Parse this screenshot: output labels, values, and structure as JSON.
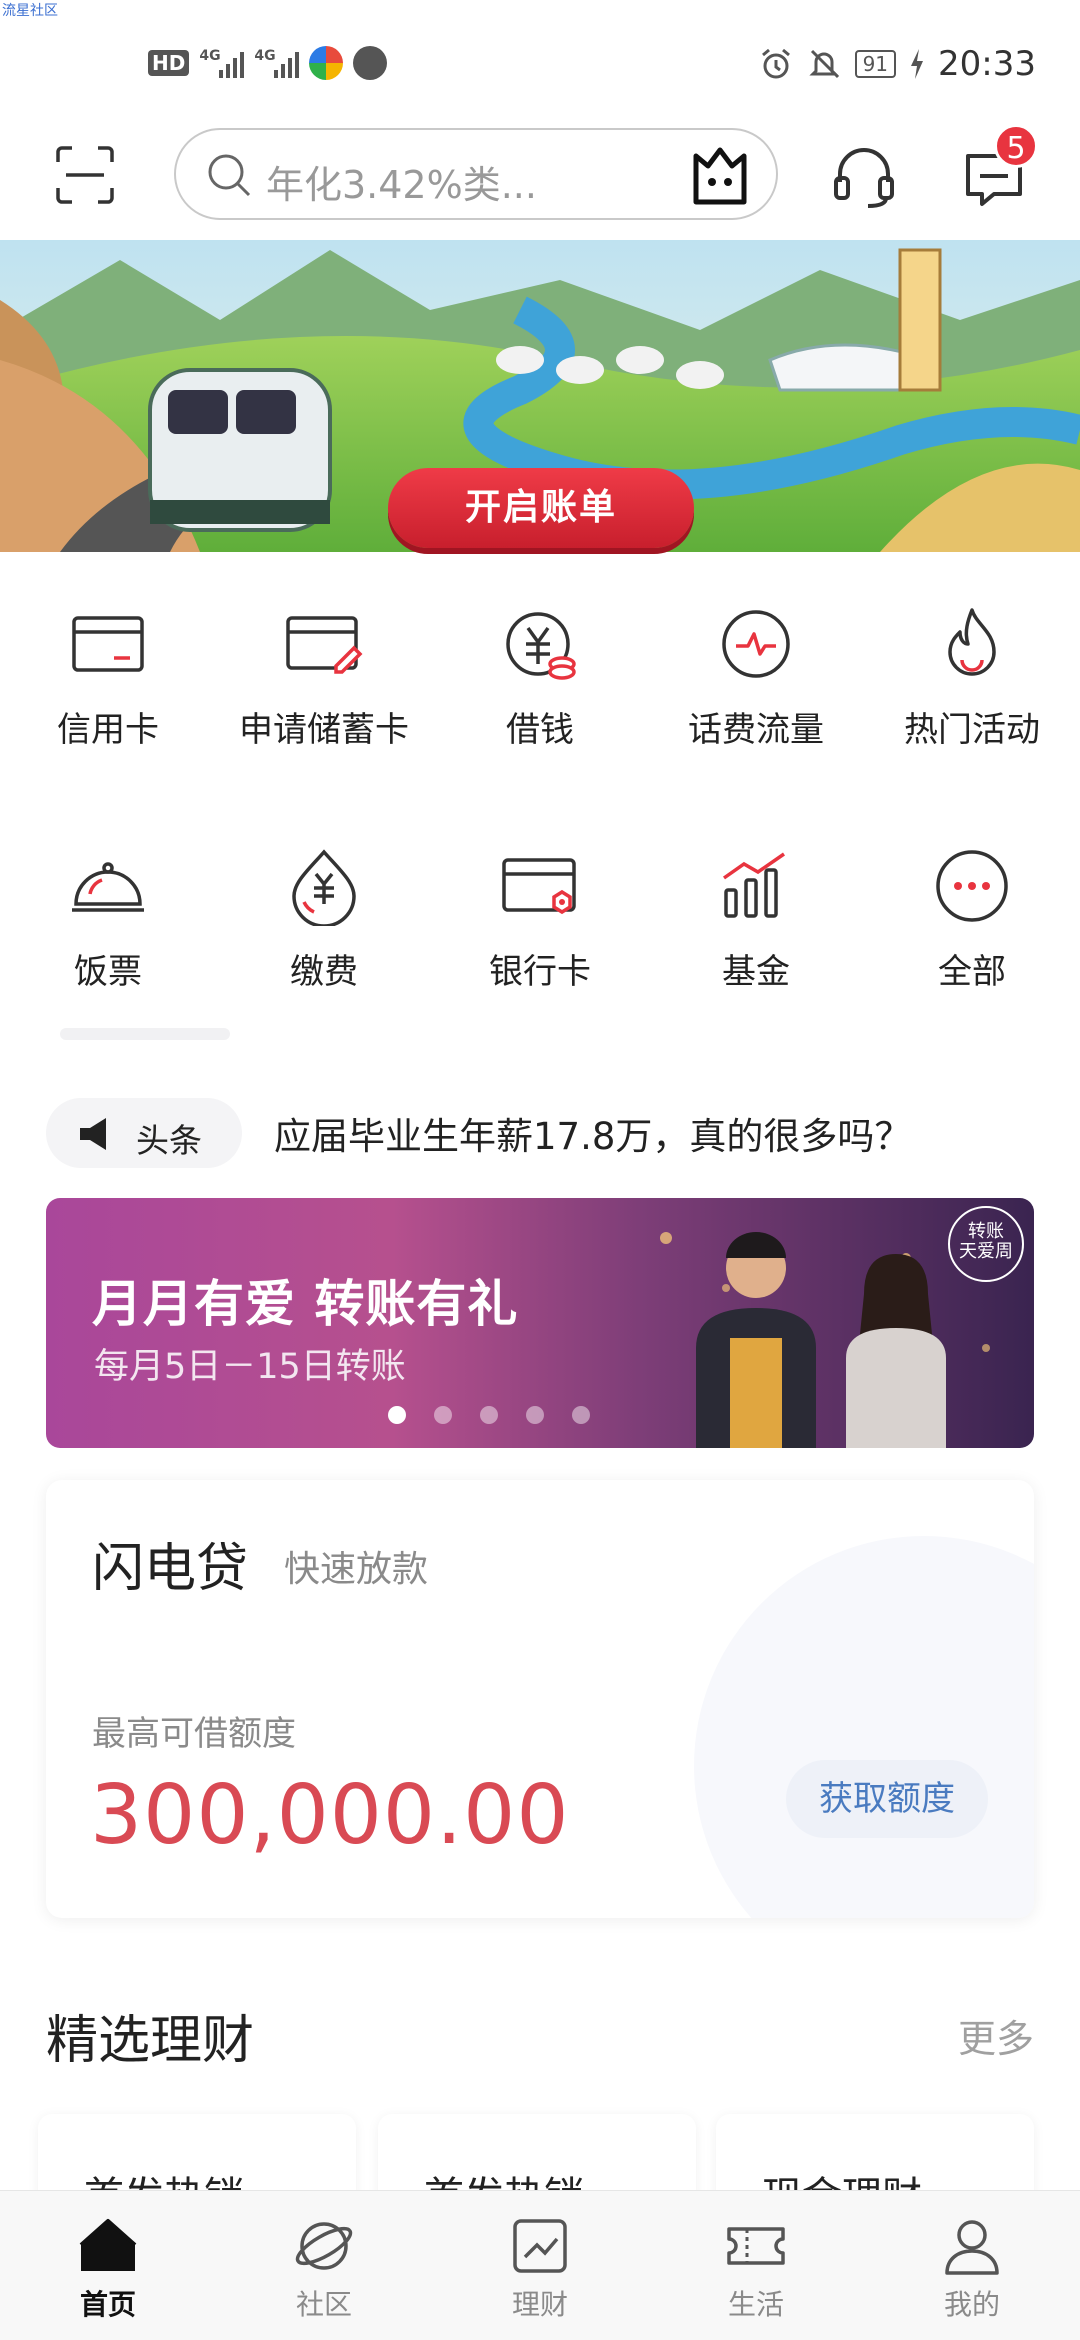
{
  "watermark": "流星社区",
  "status_bar": {
    "hd": "HD",
    "net1": "4G",
    "net2": "4G",
    "battery": "91",
    "time": "20:33"
  },
  "header": {
    "search_placeholder": "年化3.42%类...",
    "message_count": "5"
  },
  "banner": {
    "button_label": "开启账单"
  },
  "quick_icons": {
    "row1": [
      {
        "label": "信用卡",
        "icon": "credit-card-icon"
      },
      {
        "label": "申请储蓄卡",
        "icon": "apply-card-icon"
      },
      {
        "label": "借钱",
        "icon": "borrow-icon"
      },
      {
        "label": "话费流量",
        "icon": "phone-bill-icon"
      },
      {
        "label": "热门活动",
        "icon": "flame-icon"
      }
    ],
    "row2": [
      {
        "label": "饭票",
        "icon": "meal-ticket-icon"
      },
      {
        "label": "缴费",
        "icon": "payment-icon"
      },
      {
        "label": "银行卡",
        "icon": "bank-card-icon"
      },
      {
        "label": "基金",
        "icon": "fund-icon"
      },
      {
        "label": "全部",
        "icon": "more-icon"
      }
    ]
  },
  "headline": {
    "tag": "头条",
    "text": "应届毕业生年薪17.8万，真的很多吗？"
  },
  "promo": {
    "title": "月月有爱 转账有礼",
    "subtitle": "每月5日－15日转账",
    "stamp_line1": "转账",
    "stamp_line2": "天爱周"
  },
  "loan": {
    "title": "闪电贷",
    "subtitle": "快速放款",
    "limit_label": "最高可借额度",
    "limit_value": "300,000.00",
    "button": "获取额度"
  },
  "finance": {
    "title": "精选理财",
    "more": "更多",
    "cards": [
      "首发热销",
      "首发热销",
      "现金理财"
    ]
  },
  "tabs": [
    {
      "label": "首页",
      "icon": "home-icon",
      "active": true
    },
    {
      "label": "社区",
      "icon": "planet-icon",
      "active": false
    },
    {
      "label": "理财",
      "icon": "chart-icon",
      "active": false
    },
    {
      "label": "生活",
      "icon": "ticket-icon",
      "active": false
    },
    {
      "label": "我的",
      "icon": "user-icon",
      "active": false
    }
  ],
  "colors": {
    "brand_red": "#e8343f",
    "amount_red": "#d94a54",
    "link_blue": "#4a7bc0"
  }
}
